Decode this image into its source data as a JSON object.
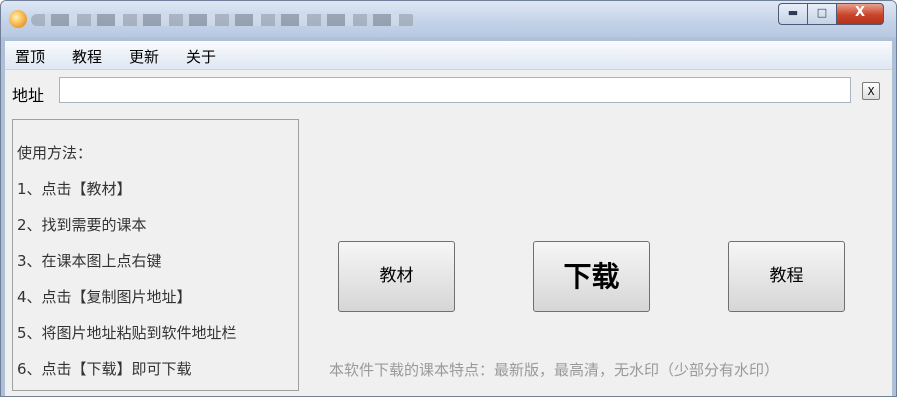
{
  "window": {
    "controls": {
      "minimize": "▬",
      "maximize": "□",
      "close": "X"
    }
  },
  "menu": [
    "置顶",
    "教程",
    "更新",
    "关于"
  ],
  "address": {
    "label": "地址",
    "value": "",
    "clear_label": "X"
  },
  "instructions": {
    "title": "使用方法：",
    "steps": [
      "1、点击【教材】",
      "2、找到需要的课本",
      "3、在课本图上点右键",
      "4、点击【复制图片地址】",
      "5、将图片地址粘贴到软件地址栏",
      "6、点击【下载】即可下载"
    ]
  },
  "buttons": {
    "textbook": "教材",
    "download": "下载",
    "tutorial": "教程"
  },
  "note": "本软件下载的课本特点：最新版，最高清，无水印（少部分有水印）"
}
